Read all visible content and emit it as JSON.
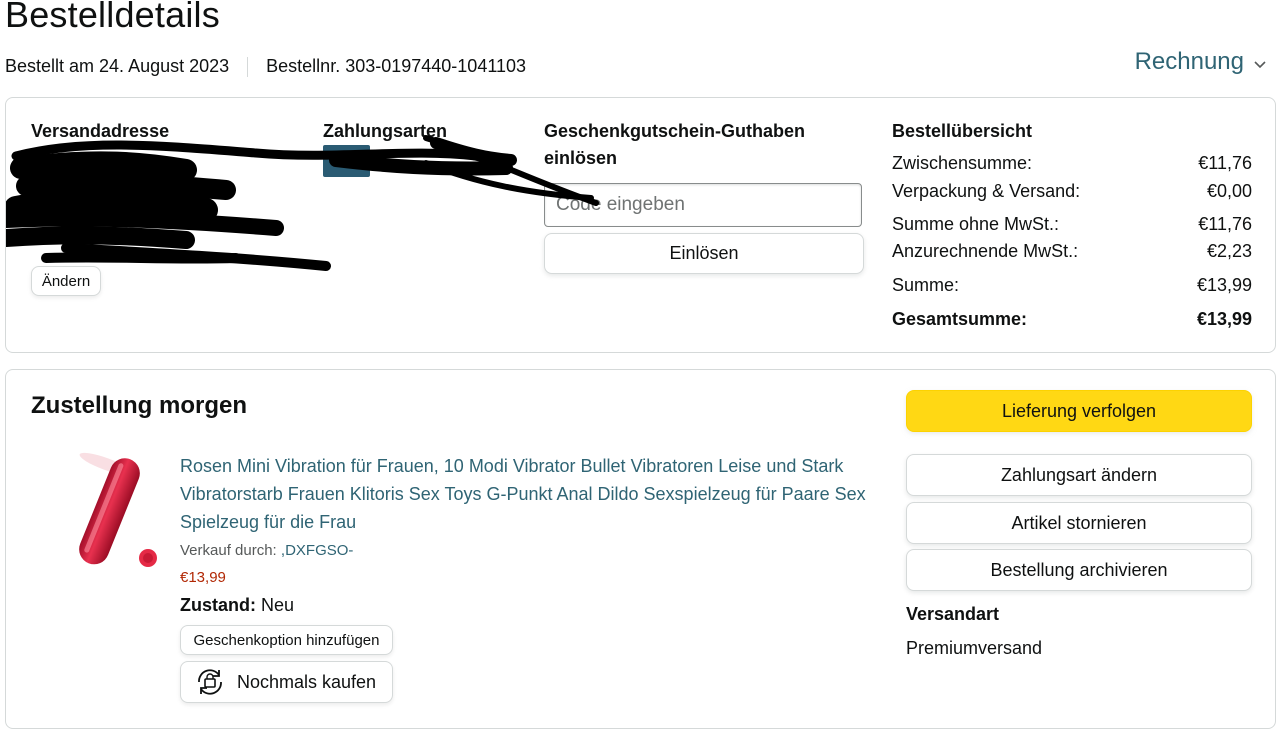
{
  "page": {
    "title": "Bestelldetails",
    "order_date": "Bestellt am 24. August 2023",
    "order_number": "Bestellnr. 303-0197440-1041103",
    "invoice_label": "Rechnung",
    "invoice_chevron": "⌄"
  },
  "address": {
    "title": "Versandadresse",
    "edit_label": "Ändern"
  },
  "payment": {
    "title": "Zahlungsarten"
  },
  "giftcard": {
    "title_line1": "Geschenkgutschein-Guthaben",
    "title_line2": "einlösen",
    "placeholder": "Code eingeben",
    "redeem_label": "Einlösen"
  },
  "summary": {
    "title": "Bestellübersicht",
    "rows": [
      {
        "label": "Zwischensumme:",
        "value": "€11,76"
      },
      {
        "label": "Verpackung & Versand:",
        "value": "€0,00"
      },
      {
        "label": "Summe ohne MwSt.:",
        "value": "€11,76"
      },
      {
        "label": "Anzurechnende MwSt.:",
        "value": "€2,23"
      },
      {
        "label": "Summe:",
        "value": "€13,99"
      },
      {
        "label": "Gesamtsumme:",
        "value": "€13,99"
      }
    ]
  },
  "shipment": {
    "title": "Zustellung morgen",
    "product": {
      "title": "Rosen Mini Vibration für Frauen, 10 Modi Vibrator Bullet Vibratoren Leise und Stark Vibratorstarb Frauen Klitoris Sex Toys G-Punkt Anal Dildo Sexspielzeug für Paare Sex Spielzeug für die Frau",
      "seller_prefix": "Verkauf durch: ",
      "seller_name": ",DXFGSO-",
      "price": "€13,99",
      "condition_label": "Zustand:",
      "condition_value": "Neu",
      "gift_option_label": "Geschenkoption hinzufügen",
      "buy_again_label": "Nochmals kaufen"
    },
    "actions": {
      "track": "Lieferung verfolgen",
      "change_payment": "Zahlungsart ändern",
      "cancel": "Artikel stornieren",
      "archive": "Bestellung archivieren"
    },
    "shipping_method_title": "Versandart",
    "shipping_method_value": "Premiumversand"
  },
  "colors": {
    "link": "#2f6474",
    "accent_yellow": "#ffd814",
    "price_red": "#b12704",
    "border": "#d5d9d9"
  },
  "icons": [
    "chevron-down-icon",
    "payment-card-icon",
    "buy-again-icon",
    "product-image"
  ]
}
